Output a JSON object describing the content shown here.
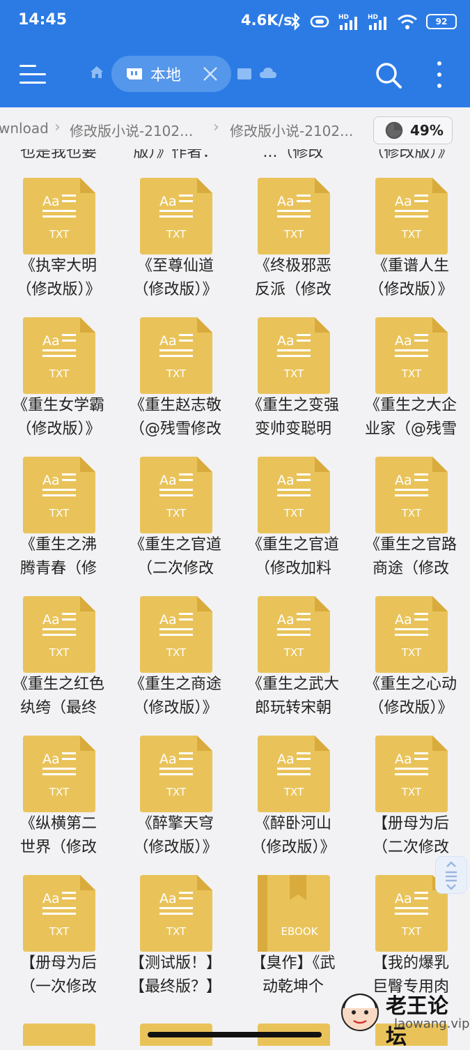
{
  "status_bar": {
    "time": "14:45",
    "net_speed": "4.6K/s",
    "battery": "92",
    "icons": [
      "bluetooth-icon",
      "vibrate-icon",
      "signal-hd-icon",
      "signal-hd-icon",
      "wifi-icon",
      "battery-icon"
    ]
  },
  "toolbar": {
    "menu_icon": "hamburger-menu-icon",
    "home_icon": "home-icon",
    "active_tab": {
      "label": "本地",
      "icon": "sd-card-icon",
      "close_icon": "close-icon"
    },
    "other_tab_icons": [
      "folder-icon",
      "cloud-icon"
    ],
    "search_icon": "search-icon",
    "more_icon": "more-vertical-icon"
  },
  "breadcrumb": {
    "crumbs": [
      "wnload",
      "修改版小说-2102...",
      "修改版小说-2102..."
    ],
    "storage_percent": "49%"
  },
  "partial_top_row": [
    "也是我也要",
    "版）》作者：",
    "...（修改",
    "（修改版）》"
  ],
  "files": [
    {
      "type": "TXT",
      "line1": "《执宰大明",
      "line2": "（修改版）》"
    },
    {
      "type": "TXT",
      "line1": "《至尊仙道",
      "line2": "（修改版）》"
    },
    {
      "type": "TXT",
      "line1": "《终极邪恶",
      "line2": "反派（修改"
    },
    {
      "type": "TXT",
      "line1": "《重谱人生",
      "line2": "（修改版）》"
    },
    {
      "type": "TXT",
      "line1": "《重生女学霸",
      "line2": "（修改版）》"
    },
    {
      "type": "TXT",
      "line1": "《重生赵志敬",
      "line2": "（@残雪修改"
    },
    {
      "type": "TXT",
      "line1": "《重生之变强",
      "line2": "变帅变聪明"
    },
    {
      "type": "TXT",
      "line1": "《重生之大企",
      "line2": "业家（@残雪"
    },
    {
      "type": "TXT",
      "line1": "《重生之沸",
      "line2": "腾青春（修"
    },
    {
      "type": "TXT",
      "line1": "《重生之官道",
      "line2": "（二次修改"
    },
    {
      "type": "TXT",
      "line1": "《重生之官道",
      "line2": "（修改加料"
    },
    {
      "type": "TXT",
      "line1": "《重生之官路",
      "line2": "商途（修改"
    },
    {
      "type": "TXT",
      "line1": "《重生之红色",
      "line2": "纨绔（最终"
    },
    {
      "type": "TXT",
      "line1": "《重生之商途",
      "line2": "（修改版）》"
    },
    {
      "type": "TXT",
      "line1": "《重生之武大",
      "line2": "郎玩转宋朝"
    },
    {
      "type": "TXT",
      "line1": "《重生之心动",
      "line2": "（修改版）》"
    },
    {
      "type": "TXT",
      "line1": "《纵横第二",
      "line2": "世界（修改"
    },
    {
      "type": "TXT",
      "line1": "《醉擎天穹",
      "line2": "（修改版）》"
    },
    {
      "type": "TXT",
      "line1": "《醉卧河山",
      "line2": "（修改版）》"
    },
    {
      "type": "TXT",
      "line1": "【册母为后",
      "line2": "（二次修改"
    },
    {
      "type": "TXT",
      "line1": "【册母为后",
      "line2": "（一次修改"
    },
    {
      "type": "TXT",
      "line1": "【测试版！】",
      "line2": "【最终版？】"
    },
    {
      "type": "EBOOK",
      "line1": "【臭作】《武",
      "line2": "动乾坤个"
    },
    {
      "type": "TXT",
      "line1": "【我的爆乳",
      "line2": "巨臀专用肉"
    }
  ],
  "file_icon_text": {
    "aa": "Aa"
  },
  "watermark": {
    "text": "老王论坛",
    "domain": "laowang.vip"
  },
  "colors": {
    "accent": "#2c7be5",
    "file_icon": "#e9c35a",
    "file_icon_fold": "#d9ab3c"
  }
}
